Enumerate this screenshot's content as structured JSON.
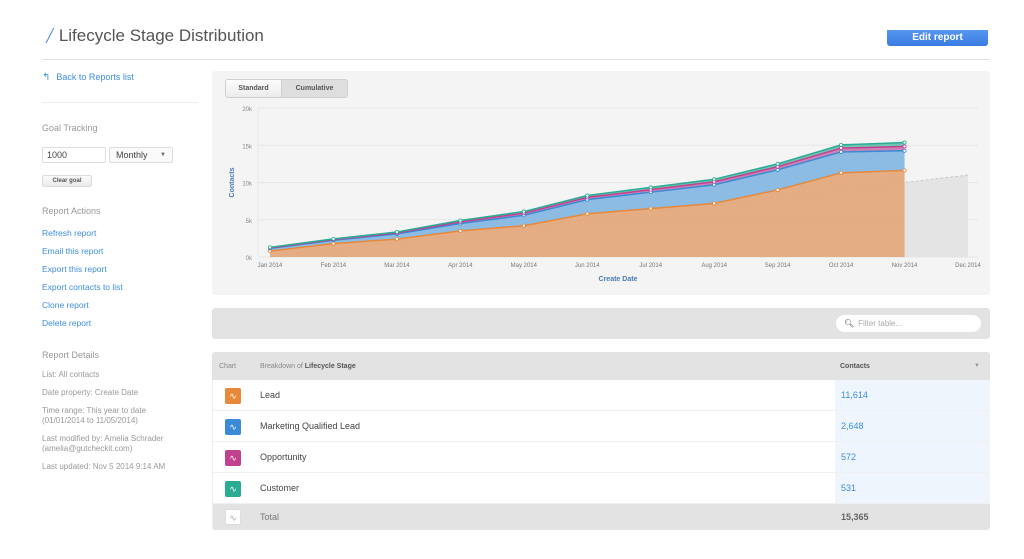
{
  "header": {
    "title": "Lifecycle Stage Distribution",
    "edit_button": "Edit report"
  },
  "sidebar": {
    "back_link": "Back to Reports list",
    "goal_tracking": {
      "label": "Goal Tracking",
      "goal_value": "1000",
      "period": "Monthly",
      "clear_button": "Clear goal"
    },
    "report_actions": {
      "label": "Report Actions",
      "links": [
        "Refresh report",
        "Email this report",
        "Export this report",
        "Export contacts to list",
        "Clone report",
        "Delete report"
      ]
    },
    "report_details": {
      "label": "Report Details",
      "list": "List: All contacts",
      "date_property": "Date property: Create Date",
      "time_range_1": "Time range: This year to date",
      "time_range_2": "(01/01/2014 to 11/05/2014)",
      "modified_1": "Last modified by: Amelia Schrader",
      "modified_2": "(amelia@gutcheckit.com)",
      "updated": "Last updated: Nov 5 2014 9:14 AM"
    }
  },
  "chart_toggle": {
    "standard": "Standard",
    "cumulative": "Cumulative",
    "active": "Cumulative"
  },
  "chart_data": {
    "type": "area",
    "stacked": true,
    "title": "",
    "xlabel": "Create Date",
    "ylabel": "Contacts",
    "ylim": [
      0,
      20000
    ],
    "yticks": [
      "0k",
      "5k",
      "10k",
      "15k",
      "20k"
    ],
    "ytick_values": [
      0,
      5000,
      10000,
      15000,
      20000
    ],
    "categories": [
      "Jan 2014",
      "Feb 2014",
      "Mar 2014",
      "Apr 2014",
      "May 2014",
      "Jun 2014",
      "Jul 2014",
      "Aug 2014",
      "Sep 2014",
      "Oct 2014",
      "Nov 2014",
      "Dec 2014"
    ],
    "grid": true,
    "series": [
      {
        "name": "Lead",
        "color": "#e8883a",
        "values": [
          800,
          1800,
          2400,
          3500,
          4200,
          5800,
          6500,
          7200,
          9000,
          11300,
          11614,
          null
        ]
      },
      {
        "name": "Marketing Qualified Lead",
        "color": "#3a8ad6",
        "values": [
          350,
          450,
          700,
          1000,
          1400,
          1900,
          2200,
          2500,
          2700,
          2800,
          2648,
          null
        ]
      },
      {
        "name": "Opportunity",
        "color": "#c2418f",
        "values": [
          80,
          100,
          130,
          220,
          280,
          300,
          340,
          400,
          420,
          520,
          572,
          null
        ]
      },
      {
        "name": "Customer",
        "color": "#2aab94",
        "values": [
          70,
          90,
          120,
          180,
          220,
          250,
          300,
          330,
          380,
          430,
          531,
          null
        ]
      }
    ],
    "goal": {
      "name": "Goal",
      "color": "#c8c8c8",
      "values": [
        0,
        1000,
        2000,
        3000,
        4000,
        5000,
        6000,
        7000,
        8000,
        9000,
        10000,
        11000
      ]
    }
  },
  "filter": {
    "placeholder": "Filter table..."
  },
  "table": {
    "headers": {
      "chart": "Chart",
      "breakdown_prefix": "Breakdown of",
      "breakdown_field": "Lifecycle Stage",
      "contacts": "Contacts"
    },
    "rows": [
      {
        "label": "Lead",
        "value": "11,614",
        "color": "#e8883a"
      },
      {
        "label": "Marketing Qualified Lead",
        "value": "2,648",
        "color": "#3a8ad6"
      },
      {
        "label": "Opportunity",
        "value": "572",
        "color": "#c2418f"
      },
      {
        "label": "Customer",
        "value": "531",
        "color": "#2aab94"
      }
    ],
    "total": {
      "label": "Total",
      "value": "15,365"
    }
  },
  "icons": {
    "pencil": "✎",
    "back_arrow": "↰",
    "pulse": "∿",
    "search": "⚲",
    "caret": "▼"
  }
}
